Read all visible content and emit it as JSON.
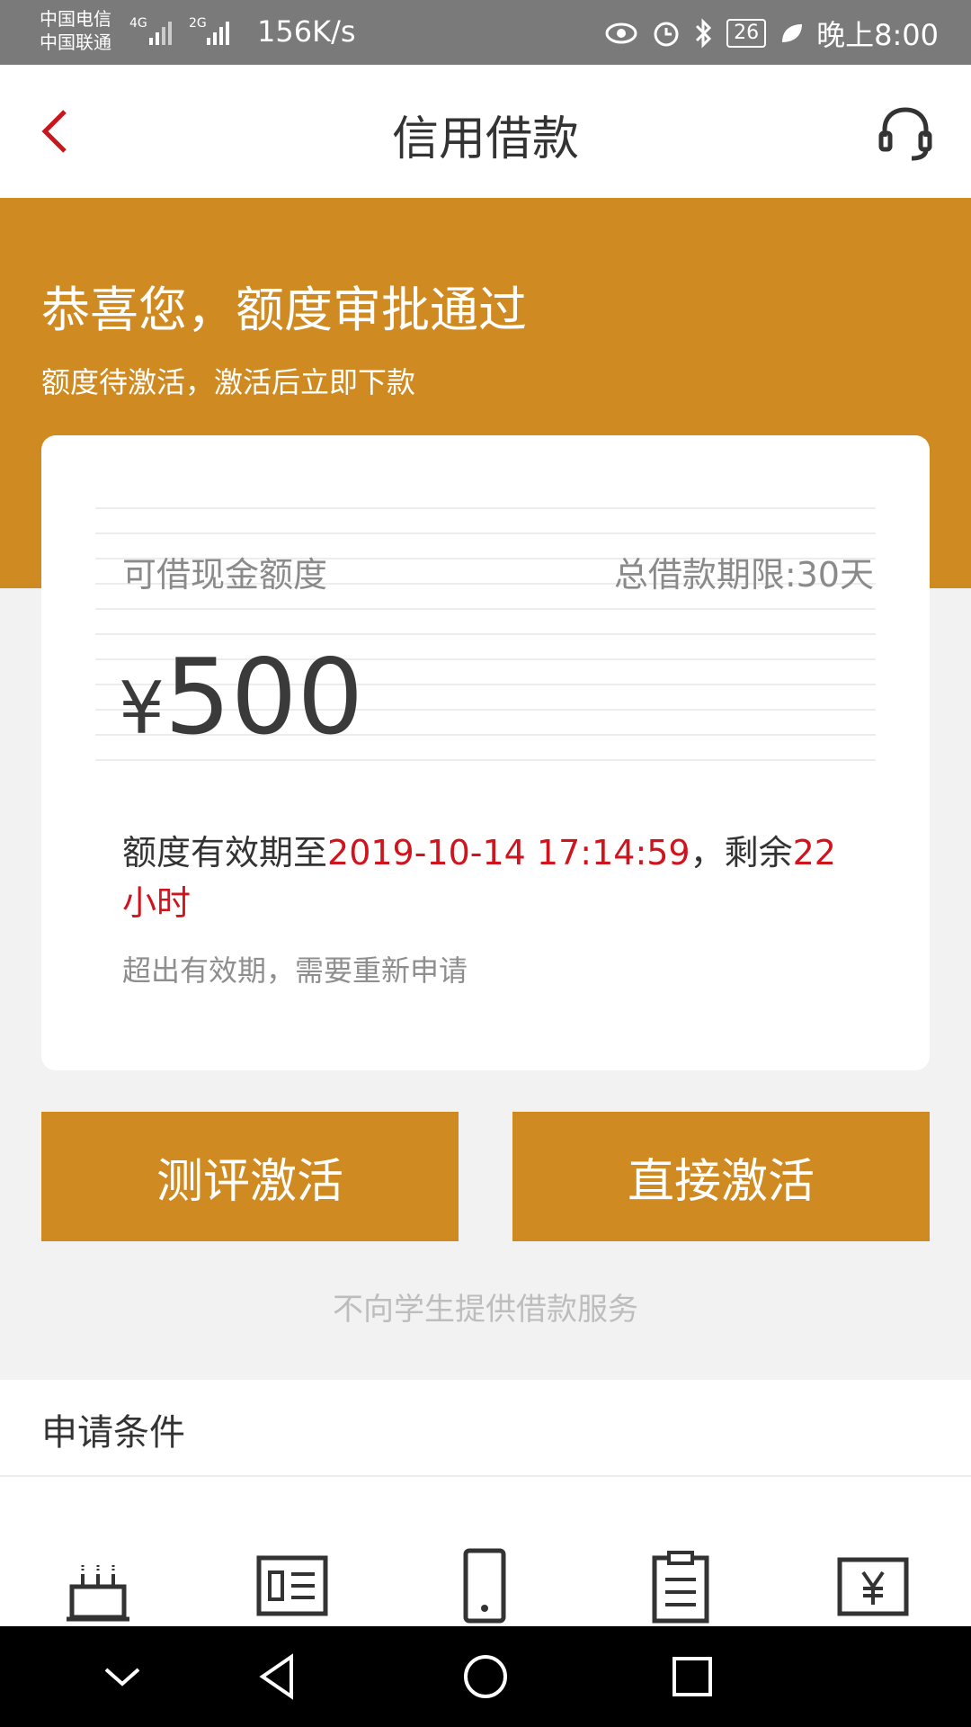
{
  "status_bar": {
    "carrier1": "中国电信",
    "carrier2": "中国联通",
    "net1": "4G",
    "net2": "2G",
    "speed": "156K/s",
    "battery": "26",
    "time": "晚上8:00"
  },
  "header": {
    "title": "信用借款",
    "back_icon": "back-chevron",
    "service_icon": "headset"
  },
  "banner": {
    "title": "恭喜您，额度审批通过",
    "subtitle": "额度待激活，激活后立即下款"
  },
  "card": {
    "label_left": "可借现金额度",
    "label_right": "总借款期限:30天",
    "currency": "¥",
    "amount": "500",
    "validity_prefix": "额度有效期至",
    "validity_datetime": "2019-10-14 17:14:59",
    "validity_middle": "，剩余",
    "validity_remaining": "22小时",
    "note": "超出有效期，需要重新申请"
  },
  "buttons": {
    "evaluate_activate": "测评激活",
    "direct_activate": "直接激活"
  },
  "disclaimer": "不向学生提供借款服务",
  "conditions": {
    "title": "申请条件",
    "icons": [
      "cake-icon",
      "id-card-icon",
      "phone-icon",
      "clipboard-icon",
      "yen-bill-icon"
    ]
  },
  "colors": {
    "accent": "#d08a22",
    "highlight_red": "#d0141e"
  },
  "nav_icons": [
    "collapse-icon",
    "back-triangle-icon",
    "home-circle-icon",
    "recents-square-icon"
  ]
}
